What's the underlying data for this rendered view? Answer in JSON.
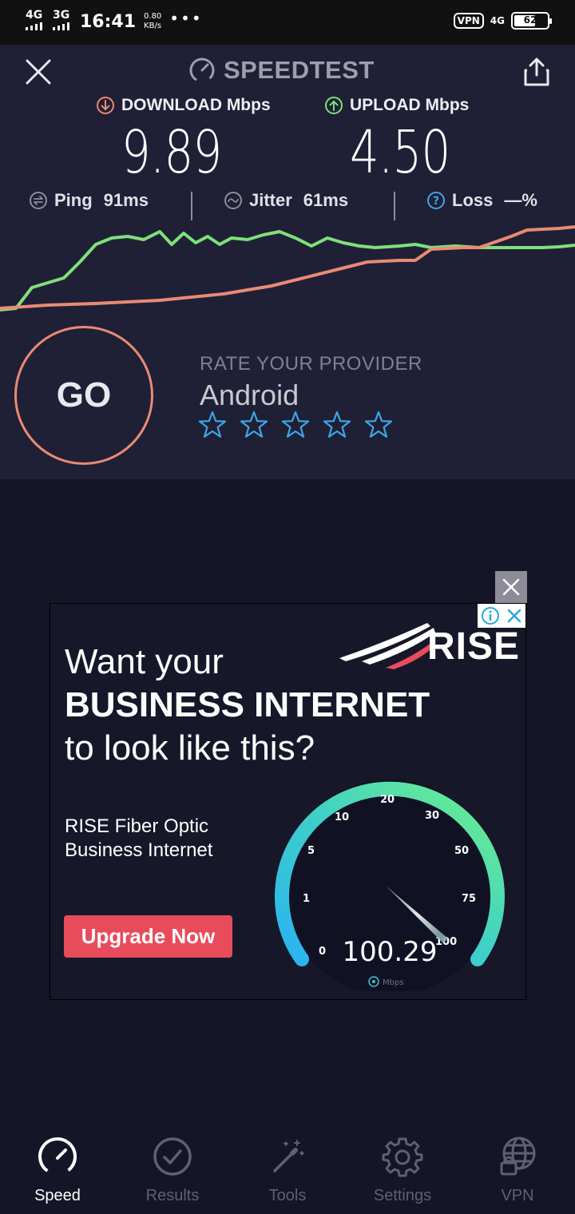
{
  "status_bar": {
    "net1": "4G",
    "net2": "3G",
    "time": "16:41",
    "speed_value": "0.80",
    "speed_unit": "KB/s",
    "more": "•••",
    "vpn": "VPN",
    "net_right": "4G",
    "battery": "62"
  },
  "header": {
    "title": "SPEEDTEST"
  },
  "results": {
    "download_label": "DOWNLOAD Mbps",
    "download_value": "9.89",
    "upload_label": "UPLOAD Mbps",
    "upload_value": "4.50"
  },
  "metrics": {
    "ping_label": "Ping",
    "ping_value": "91ms",
    "jitter_label": "Jitter",
    "jitter_value": "61ms",
    "loss_label": "Loss",
    "loss_value": "—%"
  },
  "go_button": "GO",
  "rate": {
    "title": "RATE YOUR PROVIDER",
    "provider": "Android",
    "stars_total": 5,
    "stars_selected": 0
  },
  "ad": {
    "brand": "RISE",
    "headline1": "Want your",
    "headline2": "BUSINESS INTERNET",
    "headline3": "to look like this?",
    "subtext": "RISE Fiber Optic Business Internet",
    "cta": "Upgrade Now",
    "gauge_value": "100.29",
    "gauge_unit": "Mbps",
    "gauge_ticks": [
      "0",
      "1",
      "5",
      "10",
      "20",
      "30",
      "50",
      "75",
      "100"
    ]
  },
  "nav": [
    {
      "label": "Speed",
      "icon": "speedometer-icon",
      "active": true
    },
    {
      "label": "Results",
      "icon": "check-circle-icon",
      "active": false
    },
    {
      "label": "Tools",
      "icon": "wand-icon",
      "active": false
    },
    {
      "label": "Settings",
      "icon": "gear-icon",
      "active": false
    },
    {
      "label": "VPN",
      "icon": "globe-lock-icon",
      "active": false
    }
  ],
  "colors": {
    "download": "#ea8a74",
    "upload": "#7ee07a",
    "background": "#141526",
    "panel": "#1f2035",
    "cta": "#e84c5b"
  }
}
